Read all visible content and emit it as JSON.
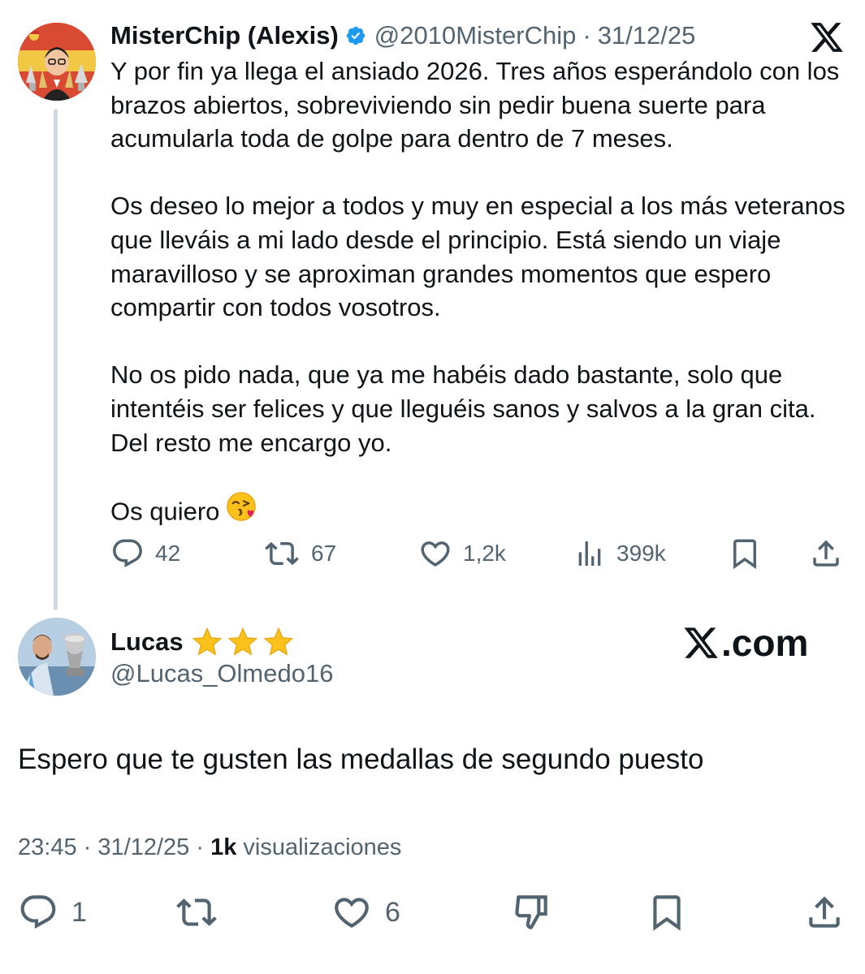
{
  "original_tweet": {
    "author_name": "MisterChip (Alexis)",
    "handle": "@2010MisterChip",
    "separator": "·",
    "date": "31/12/25",
    "paragraphs": [
      "Y por fin ya llega el ansiado 2026. Tres años esperándolo con los brazos abiertos, sobreviviendo sin pedir buena suerte para acumularla toda de golpe para dentro de 7 meses.",
      "Os deseo lo mejor a todos y muy en especial a los más veteranos que lleváis a mi lado desde el principio. Está siendo un viaje maravilloso y se aproximan grandes momentos que espero compartir con todos vosotros.",
      "No os pido nada, que ya me habéis dado bastante, solo que intentéis ser felices y que lleguéis sanos y salvos a la gran cita. Del resto me encargo yo.",
      "Os quiero"
    ],
    "emoji": "face-blowing-a-kiss",
    "stats": {
      "replies": "42",
      "reposts": "67",
      "likes": "1,2k",
      "views": "399k"
    }
  },
  "reply_tweet": {
    "author_name": "Lucas",
    "handle": "@Lucas_Olmedo16",
    "stars": 3,
    "watermark": ".com",
    "text": "Espero que te gusten las medallas de segundo puesto",
    "time": "23:45",
    "date": "31/12/25",
    "separator": "·",
    "views_count": "1k",
    "views_label": "visualizaciones",
    "stats": {
      "replies": "1",
      "likes": "6"
    }
  },
  "colors": {
    "text_primary": "#0f1419",
    "text_secondary": "#536471",
    "verified_blue": "#1d9bf0",
    "thread_line": "#cfd9de"
  }
}
